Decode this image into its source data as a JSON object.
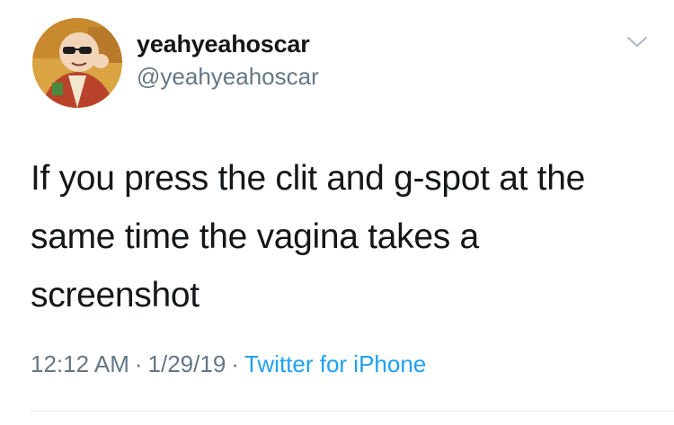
{
  "user": {
    "display_name": "yeahyeahoscar",
    "handle": "@yeahyeahoscar",
    "avatar_icon": "cartoon-avatar-icon"
  },
  "menu": {
    "icon": "chevron-down-icon"
  },
  "tweet": {
    "lines": [
      "If you press the clit and g-spot at the",
      "same time the vagina takes a",
      "screenshot"
    ]
  },
  "meta": {
    "time": "12:12 AM",
    "date": "1/29/19",
    "separator": "·",
    "source": "Twitter for iPhone"
  },
  "colors": {
    "text": "#14171a",
    "secondary": "#657786",
    "link": "#1da1f2",
    "divider": "#e1e8ed"
  }
}
